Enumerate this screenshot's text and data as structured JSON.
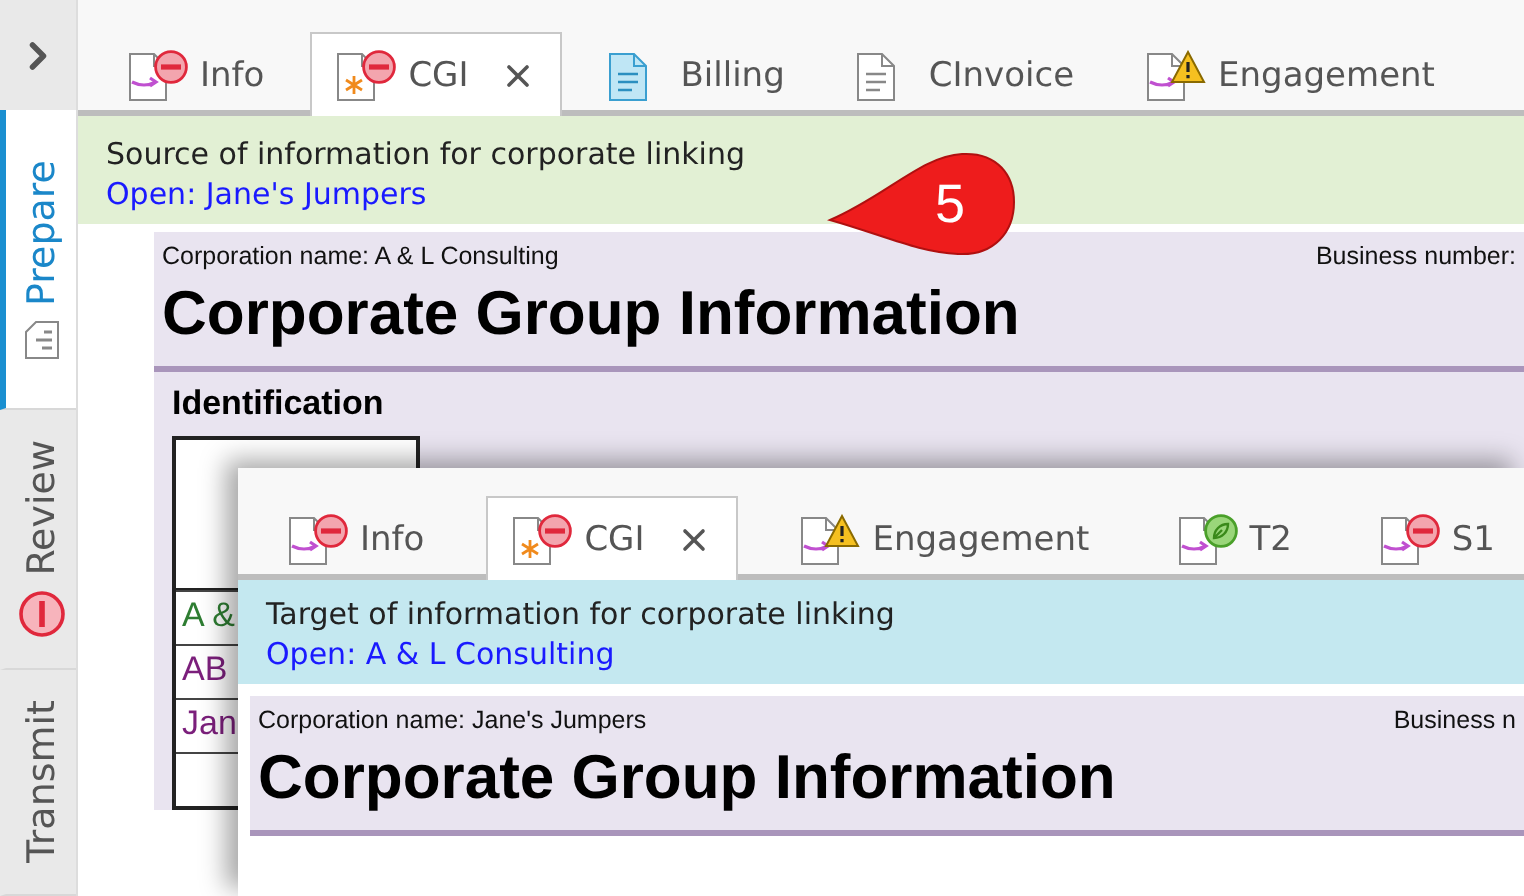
{
  "sidebar": {
    "items": [
      {
        "label": "Prepare",
        "selected": true,
        "errors": false
      },
      {
        "label": "Review",
        "selected": false,
        "errors": true
      },
      {
        "label": "Transmit",
        "selected": false,
        "errors": false
      }
    ]
  },
  "source_window": {
    "tabs": [
      {
        "label": "Info",
        "selected": false,
        "kind": "transfer",
        "errors": true,
        "warning": false,
        "complete": false
      },
      {
        "label": "CGI",
        "selected": true,
        "kind": "worksheet",
        "errors": true,
        "warning": false,
        "complete": false
      },
      {
        "label": "Billing",
        "selected": false,
        "kind": "billing",
        "errors": false,
        "warning": false,
        "complete": false
      },
      {
        "label": "CInvoice",
        "selected": false,
        "kind": "text",
        "errors": false,
        "warning": false,
        "complete": false
      },
      {
        "label": "Engagement",
        "selected": false,
        "kind": "transfer",
        "errors": false,
        "warning": true,
        "complete": false
      }
    ],
    "banner": {
      "kind": "source",
      "text": "Source of information for corporate linking",
      "link": "Open: Jane's Jumpers"
    },
    "form": {
      "corporation_name": "Corporation name: A & L Consulting",
      "business_number": "Business number:",
      "title": "Corporate Group Information",
      "section": "Identification",
      "rows": [
        {
          "text": "A &",
          "color": "#2e7d32"
        },
        {
          "text": "AB",
          "color": "#7b1f7b"
        },
        {
          "text": "Jan",
          "color": "#7b1f7b"
        }
      ]
    }
  },
  "callout": {
    "number": "5"
  },
  "target_window": {
    "tabs": [
      {
        "label": "Info",
        "selected": false,
        "kind": "transfer",
        "errors": true,
        "warning": false,
        "complete": false
      },
      {
        "label": "CGI",
        "selected": true,
        "kind": "worksheet",
        "errors": true,
        "warning": false,
        "complete": false
      },
      {
        "label": "Engagement",
        "selected": false,
        "kind": "transfer",
        "errors": false,
        "warning": true,
        "complete": false
      },
      {
        "label": "T2",
        "selected": false,
        "kind": "transfer",
        "errors": false,
        "warning": false,
        "complete": true
      },
      {
        "label": "S1",
        "selected": false,
        "kind": "transfer",
        "errors": true,
        "warning": false,
        "complete": false
      }
    ],
    "banner": {
      "kind": "target",
      "text": "Target of information for corporate linking",
      "link": "Open: A & L Consulting"
    },
    "form": {
      "corporation_name": "Corporation name: Jane's Jumpers",
      "business_number": "Business n",
      "title": "Corporate Group Information"
    }
  }
}
